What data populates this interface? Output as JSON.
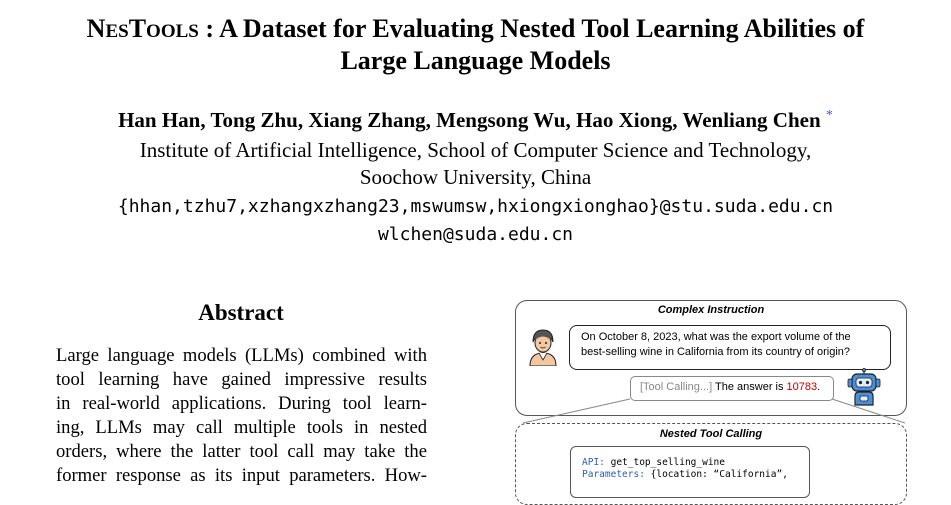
{
  "paper": {
    "title_sc_1": "N",
    "title_sc_2": "ES",
    "title_sc_3": "T",
    "title_sc_4": "OOLS",
    "title_rest_line1": " : A Dataset for Evaluating Nested Tool Learning Abilities of",
    "title_line2": "Large Language Models",
    "authors": "Han Han, Tong Zhu, Xiang Zhang, Mengsong Wu, Hao Xiong, Wenliang Chen",
    "author_mark": "*",
    "affiliation_line1": "Institute of Artificial Intelligence, School of Computer Science and Technology,",
    "affiliation_line2": "Soochow University, China",
    "email_line1": "{hhan,tzhu7,xzhangxzhang23,mswumsw,hxiongxionghao}@stu.suda.edu.cn",
    "email_line2": "wlchen@suda.edu.cn"
  },
  "abstract": {
    "heading": "Abstract",
    "lines": [
      "Large language models (LLMs) combined with",
      "tool learning have gained impressive results",
      "in real-world applications.  During tool learn-",
      "ing, LLMs may call multiple tools in nested",
      "orders, where the latter tool call may take the",
      "former response as its input parameters.  How-"
    ]
  },
  "figure": {
    "complex_title": "Complex Instruction",
    "instruction_line1": "On October 8, 2023, what was the export volume of the",
    "instruction_line2": "best-selling wine in California from its country of origin?",
    "tool_calling_tag": "[Tool Calling...]",
    "answer_prefix": " The answer is ",
    "answer_value": "10783",
    "answer_suffix": ".",
    "nested_title": "Nested Tool Calling",
    "api_key": "API:",
    "api_value": " get_top_selling_wine",
    "params_key": "Parameters:",
    "params_value": " {location: “California”,",
    "accent_color": "#c00000",
    "key_color": "#2a5dbf"
  }
}
